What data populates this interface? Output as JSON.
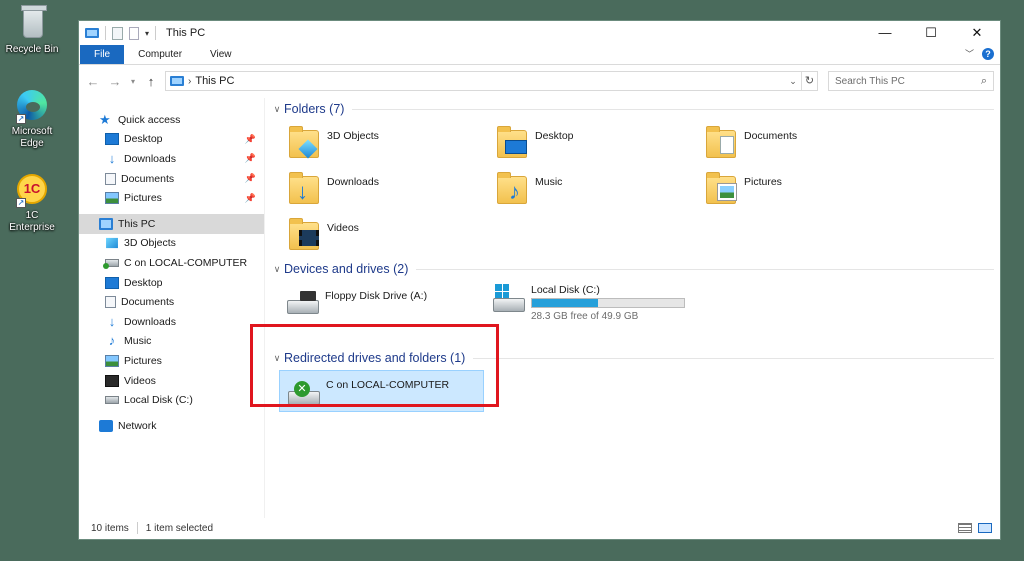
{
  "desktop": {
    "icons": [
      {
        "label": "Recycle Bin"
      },
      {
        "label": "Microsoft Edge"
      },
      {
        "label": "1C Enterprise"
      }
    ]
  },
  "window": {
    "title": "This PC",
    "controls": {
      "minimize": "—",
      "maximize": "☐",
      "close": "✕"
    }
  },
  "ribbon": {
    "tabs": [
      "File",
      "Computer",
      "View"
    ],
    "help": "?"
  },
  "address": {
    "path": "This PC",
    "search_placeholder": "Search This PC"
  },
  "nav": {
    "quick_access": "Quick access",
    "quick_items": [
      "Desktop",
      "Downloads",
      "Documents",
      "Pictures"
    ],
    "this_pc": "This PC",
    "pc_items": [
      "3D Objects",
      "C on LOCAL-COMPUTER",
      "Desktop",
      "Documents",
      "Downloads",
      "Music",
      "Pictures",
      "Videos",
      "Local Disk (C:)"
    ],
    "network": "Network"
  },
  "content": {
    "folders_header": "Folders (7)",
    "folders": [
      "3D Objects",
      "Desktop",
      "Documents",
      "Downloads",
      "Music",
      "Pictures",
      "Videos"
    ],
    "devices_header": "Devices and drives (2)",
    "floppy": "Floppy Disk Drive (A:)",
    "local_disk": {
      "name": "Local Disk (C:)",
      "free_text": "28.3 GB free of 49.9 GB",
      "used_fraction": 0.433
    },
    "redirected_header": "Redirected drives and folders (1)",
    "redirected_item": "C on LOCAL-COMPUTER"
  },
  "status": {
    "items": "10 items",
    "selected": "1 item selected"
  },
  "colors": {
    "accent": "#1a69c0",
    "highlight_box": "#e0161e",
    "capacity_fill": "#26a0da"
  }
}
